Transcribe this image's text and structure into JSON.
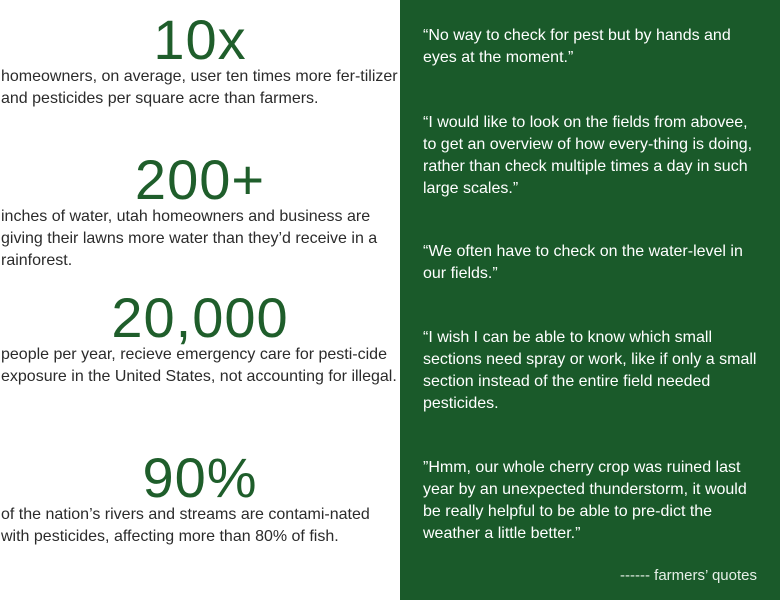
{
  "stats": [
    {
      "number": "10x",
      "text": "homeowners, on average, user ten times more fer-tilizer and pesticides per square acre than farmers."
    },
    {
      "number": "200+",
      "text": "inches of water, utah homeowners and business are giving their lawns more water than they’d receive in a rainforest."
    },
    {
      "number": "20,000",
      "text": "people per year, recieve emergency care for pesti-cide exposure in the United States, not accounting for illegal."
    },
    {
      "number": "90%",
      "text": "of the nation’s rivers and streams are contami-nated with pesticides, affecting more than 80% of fish."
    }
  ],
  "quotes": [
    "“No way to check for pest but by hands and eyes at the moment.”",
    "“I would like to look on the fields from aboveе, to get an overview of how every-thing is doing, rather than check multiple times a day in such large scales.”",
    "“We often have to check on the water-level in our fields.”",
    "“I wish I can be able to know which small sections need spray or work, like if only a small section instead of the entire field needed pesticides.",
    "”Hmm, our whole cherry crop was ruined last year by an unexpected thunderstorm, it would be really helpful to be able to pre-dict the weather a little better.”"
  ],
  "attribution": "------ farmers’ quotes",
  "colors": {
    "panel": "#1a5a2a",
    "number": "#1f5e2b",
    "text": "#2b2b2b",
    "quote_text": "#ffffff"
  }
}
